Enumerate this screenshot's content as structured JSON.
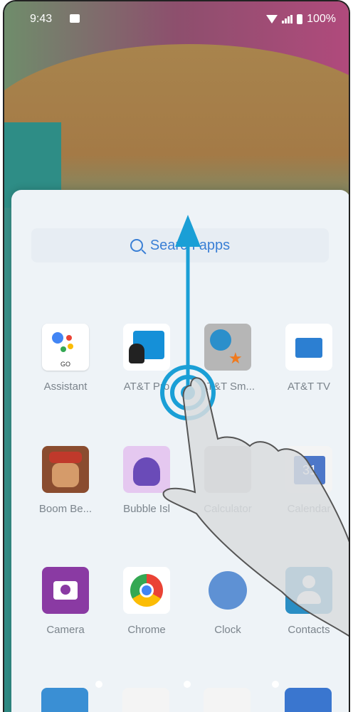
{
  "status_bar": {
    "time": "9:43",
    "battery": "100%"
  },
  "search": {
    "placeholder": "Search apps"
  },
  "apps": [
    {
      "label": "Assistant",
      "icon": "google-assistant-icon"
    },
    {
      "label": "AT&T Pro",
      "icon": "att-pro-icon"
    },
    {
      "label": "AT&T Sm...",
      "icon": "att-smart-wifi-icon"
    },
    {
      "label": "AT&T TV",
      "icon": "att-tv-icon"
    },
    {
      "label": "Boom Be...",
      "icon": "boom-beach-icon"
    },
    {
      "label": "Bubble Isl",
      "icon": "bubble-island-icon"
    },
    {
      "label": "Calculator",
      "icon": "calculator-icon"
    },
    {
      "label": "Calendar",
      "icon": "calendar-icon"
    },
    {
      "label": "Camera",
      "icon": "camera-icon"
    },
    {
      "label": "Chrome",
      "icon": "chrome-icon"
    },
    {
      "label": "Clock",
      "icon": "clock-icon"
    },
    {
      "label": "Contacts",
      "icon": "contacts-icon"
    }
  ],
  "assistant_badge": "GO",
  "calendar_day": "31",
  "gesture": {
    "direction": "swipe-up",
    "arrow_color": "#1a9fd6"
  }
}
